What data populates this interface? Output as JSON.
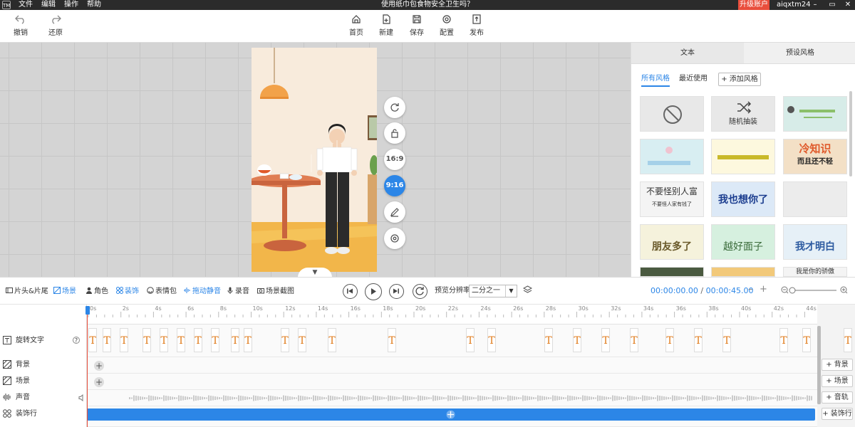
{
  "titlebar": {
    "logo": "TM",
    "menu": [
      "文件",
      "编辑",
      "操作",
      "帮助"
    ],
    "title": "使用纸巾包食物安全卫生吗？",
    "upgrade": "升级账户",
    "user": "aiqxtm24",
    "win": [
      "–",
      "▭",
      "✕"
    ]
  },
  "toolbar": {
    "undo": "撤销",
    "redo": "还原",
    "home": "首页",
    "new": "新建",
    "save": "保存",
    "config": "配置",
    "publish": "发布"
  },
  "canvas": {
    "ratio_169": "16:9",
    "ratio_916": "9:16",
    "collapse": "▼"
  },
  "right_panel": {
    "tab_text": "文本",
    "tab_preset": "预设风格",
    "sub_all": "所有风格",
    "sub_recent": "最近使用",
    "add_style": "+ 添加风格",
    "random_label": "随机抽装",
    "style_texts": [
      "冷知识",
      "而且还不轻",
      "不要怪别人富",
      "不要怪人家有钱了",
      "我也想你了",
      "朋友多了",
      "越好面子",
      "我才明白",
      "我是你的骄傲"
    ]
  },
  "timeline_toolbar": {
    "opening": "片头&片尾",
    "scene": "场景",
    "role": "角色",
    "decor": "装饰",
    "emoji": "表情包",
    "drag_mute": "拖动静音",
    "record": "录音",
    "screenshot": "场景截图",
    "res_label": "预览分辨率",
    "res_value": "二分之一",
    "time_current": "00:00:00.00",
    "time_sep": "/",
    "time_total": "00:00:45.00",
    "minus": "–",
    "plus": "+"
  },
  "ruler": [
    "0s",
    "2s",
    "4s",
    "6s",
    "8s",
    "10s",
    "12s",
    "14s",
    "16s",
    "18s",
    "20s",
    "22s",
    "24s",
    "26s",
    "28s",
    "30s",
    "32s",
    "34s",
    "36s",
    "38s",
    "40s",
    "42s",
    "44s"
  ],
  "tracks": {
    "rotate_text": "旋转文字",
    "help": "?",
    "background": "背景",
    "scene": "场景",
    "sound": "声音",
    "decor_row": "装饰行",
    "clip_glyph": "T",
    "add_bg": "+ 背景",
    "add_scene": "+ 场景",
    "add_audio": "+ 音轨",
    "add_decor": "+ 装饰行",
    "plus": "+"
  },
  "colors": {
    "accent": "#2c86e7",
    "upgrade": "#e94e3c",
    "clip_text": "#e07a1a"
  }
}
